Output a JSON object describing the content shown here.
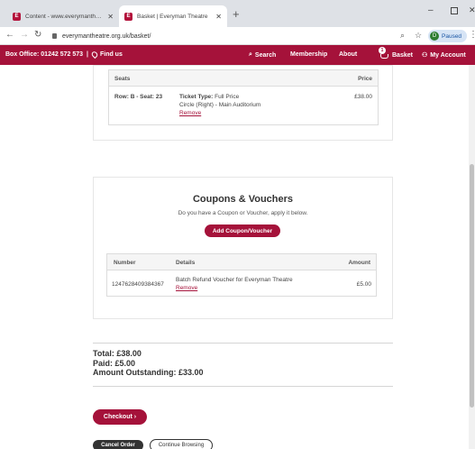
{
  "browser": {
    "tabs": [
      {
        "title": "Content - www.everymantheatre.org.uk",
        "active": false
      },
      {
        "title": "Basket | Everyman Theatre",
        "active": true
      }
    ],
    "new_tab": "+",
    "url": "everymantheatre.org.uk/basket/",
    "profile_initial": "D",
    "profile_status": "Paused"
  },
  "header": {
    "box_office": "Box Office: 01242 572 573",
    "separator": "|",
    "find_us": "Find us",
    "nav": {
      "search": "Search",
      "membership": "Membership",
      "about": "About",
      "basket": "Basket",
      "basket_count": "1",
      "account": "My Account"
    },
    "colors": {
      "brand": "#a5123a"
    }
  },
  "seats": {
    "columns": {
      "seats": "Seats",
      "price": "Price"
    },
    "row": {
      "seat": "Row: B - Seat: 23",
      "ticket_label": "Ticket Type:",
      "ticket_type": "Full Price",
      "location": "Circle (Right)  -  Main Auditorium",
      "remove": "Remove",
      "price": "£38.00"
    }
  },
  "vouchers": {
    "title": "Coupons & Vouchers",
    "subtitle": "Do you have a Coupon or Voucher, apply it below.",
    "add_button": "Add Coupon/Voucher",
    "columns": {
      "number": "Number",
      "details": "Details",
      "amount": "Amount"
    },
    "row": {
      "number": "1247628409384367",
      "details": "Batch Refund Voucher for Everyman Theatre",
      "remove": "Remove",
      "amount": "£5.00"
    }
  },
  "totals": {
    "total": "Total: £38.00",
    "paid": "Paid: £5.00",
    "outstanding": "Amount Outstanding: £33.00"
  },
  "actions": {
    "checkout": "Checkout ›",
    "cancel": "Cancel Order",
    "continue": "Continue Browsing"
  }
}
